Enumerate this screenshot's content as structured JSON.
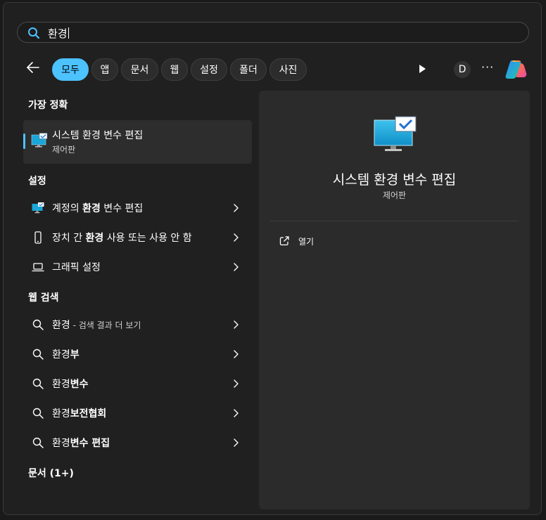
{
  "search": {
    "query": "환경"
  },
  "filters": {
    "tabs": [
      {
        "label": "모두",
        "active": true
      },
      {
        "label": "앱"
      },
      {
        "label": "문서"
      },
      {
        "label": "웹"
      },
      {
        "label": "설정"
      },
      {
        "label": "폴더"
      },
      {
        "label": "사진"
      }
    ],
    "avatar_letter": "D",
    "more_label": "···"
  },
  "best_match": {
    "section": "가장 정확",
    "title": "시스템 환경 변수 편집",
    "subtitle": "제어판"
  },
  "settings": {
    "section": "설정",
    "items": [
      {
        "pre": "계정의 ",
        "bold": "환경",
        "post": " 변수 편집",
        "icon": "monitor-settings-icon"
      },
      {
        "pre": "장치 간 ",
        "bold": "환경",
        "post": " 사용 또는 사용 안 함",
        "icon": "phone-icon"
      },
      {
        "pre": "그래픽 설정",
        "bold": "",
        "post": "",
        "icon": "laptop-icon"
      }
    ]
  },
  "web": {
    "section": "웹 검색",
    "items": [
      {
        "pre": "환경",
        "bold": "",
        "post": "",
        "sub": " - 검색 결과 더 보기"
      },
      {
        "pre": "환경",
        "bold": "부",
        "post": "",
        "sub": ""
      },
      {
        "pre": "환경",
        "bold": "변수",
        "post": "",
        "sub": ""
      },
      {
        "pre": "환경",
        "bold": "보전협회",
        "post": "",
        "sub": ""
      },
      {
        "pre": "환경",
        "bold": "변수 편집",
        "post": "",
        "sub": ""
      }
    ]
  },
  "documents": {
    "section": "문서 (1+)"
  },
  "detail": {
    "title": "시스템 환경 변수 편집",
    "subtitle": "제어판",
    "open_label": "열기"
  },
  "colors": {
    "accent": "#4cc2ff",
    "panel": "#202020",
    "card": "#2b2b2b"
  }
}
